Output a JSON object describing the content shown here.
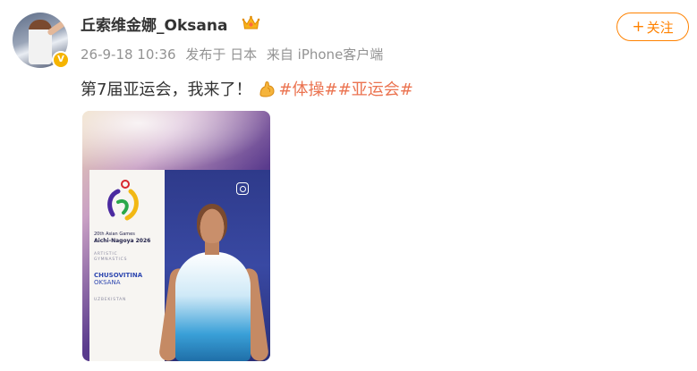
{
  "user": {
    "name": "丘索维金娜_Oksana",
    "verified_badge": "V",
    "avatar_icon": "avatar-photo",
    "crown_icon": "crown-icon"
  },
  "meta": {
    "timestamp": "26-9-18 10:36",
    "location": "发布于 日本",
    "source": "来自 iPhone客户端"
  },
  "follow_button": {
    "plus": "+",
    "label": "关注",
    "color": "#ff8200"
  },
  "post": {
    "text": "第7届亚运会，我来了！",
    "emoji_icon": "flexed-biceps-icon",
    "hashtags": [
      "#体操#",
      "#亚运会#"
    ],
    "hashtag_color": "#eb7350"
  },
  "photo": {
    "games_line1": "20th Asian Games",
    "games_line2": "Aichi-Nagoya 2026",
    "discipline_line1": "ARTISTIC",
    "discipline_line2": "GYMNASTICS",
    "athlete_last": "CHUSOVITINA",
    "athlete_first": "OKSANA",
    "country": "UZBEKISTAN"
  }
}
